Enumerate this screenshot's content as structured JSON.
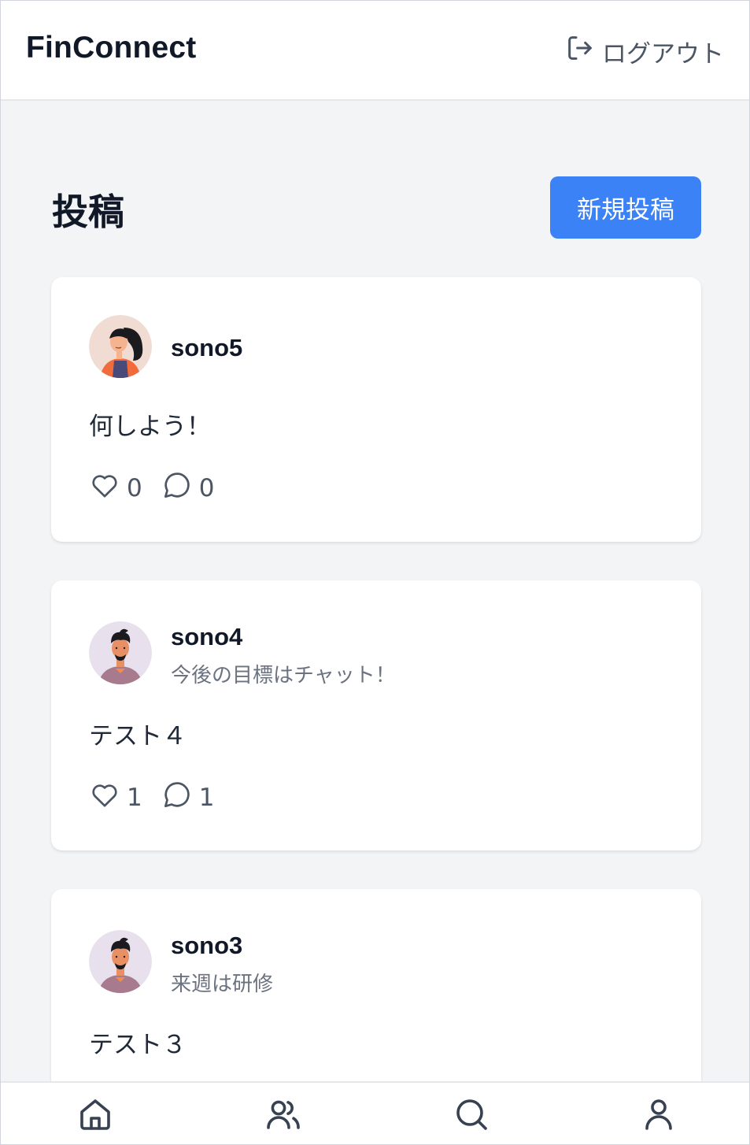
{
  "header": {
    "brand": "FinConnect",
    "logout_label": "ログアウト",
    "logout_icon": "logout-icon"
  },
  "page": {
    "title": "投稿",
    "new_post_label": "新規投稿"
  },
  "posts": [
    {
      "username": "sono5",
      "bio": "",
      "content": "何しよう！",
      "likes": "0",
      "comments": "0",
      "avatar": "female-avatar"
    },
    {
      "username": "sono4",
      "bio": "今後の目標はチャット！",
      "content": "テスト４",
      "likes": "1",
      "comments": "1",
      "avatar": "male-avatar"
    },
    {
      "username": "sono3",
      "bio": "来週は研修",
      "content": "テスト３",
      "avatar": "male-avatar"
    }
  ],
  "bottom_nav": {
    "items": [
      "home-icon",
      "users-icon",
      "search-icon",
      "user-icon"
    ]
  },
  "colors": {
    "accent": "#3b82f6",
    "background": "#f3f4f6",
    "card": "#ffffff",
    "text_primary": "#111827",
    "text_secondary": "#6b7280"
  }
}
